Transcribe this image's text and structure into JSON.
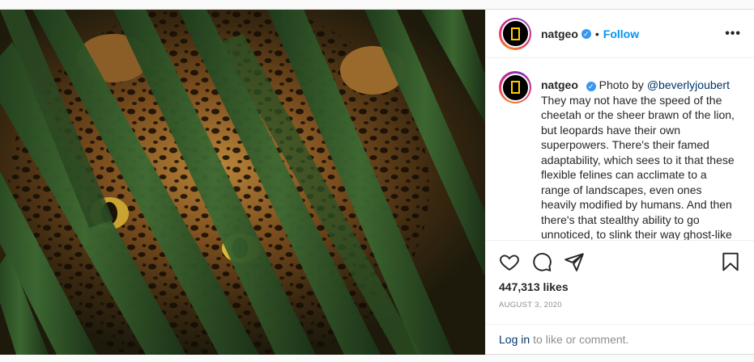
{
  "post": {
    "username": "natgeo",
    "verified_icon": "verified-badge-icon",
    "separator": "•",
    "follow_label": "Follow",
    "more_icon": "more-options-icon",
    "more_label": "•••",
    "caption": {
      "username": "natgeo",
      "prefix": "Photo by ",
      "mention": "@beverlyjoubert",
      "text": "They may not have the speed of the cheetah or the sheer brawn of the lion, but leopards have their own superpowers. There's their famed adaptability, which sees to it that these flexible felines can acclimate to a range of landscapes, even ones heavily modified by humans. And then there's that stealthy ability to go unnoticed, to slink their way ghost-like"
    },
    "likes": "447,313 likes",
    "date": "AUGUST 3, 2020",
    "login_link": "Log in",
    "login_suffix": "to like or comment."
  },
  "colors": {
    "brand_yellow": "#ffce00",
    "link_blue": "#0095f6",
    "mention_blue": "#00376b",
    "verified_blue": "#3897f0",
    "muted_gray": "#8e8e8e"
  },
  "icons": [
    "heart-icon",
    "comment-icon",
    "share-icon",
    "bookmark-icon",
    "verified-badge-icon",
    "more-options-icon"
  ]
}
